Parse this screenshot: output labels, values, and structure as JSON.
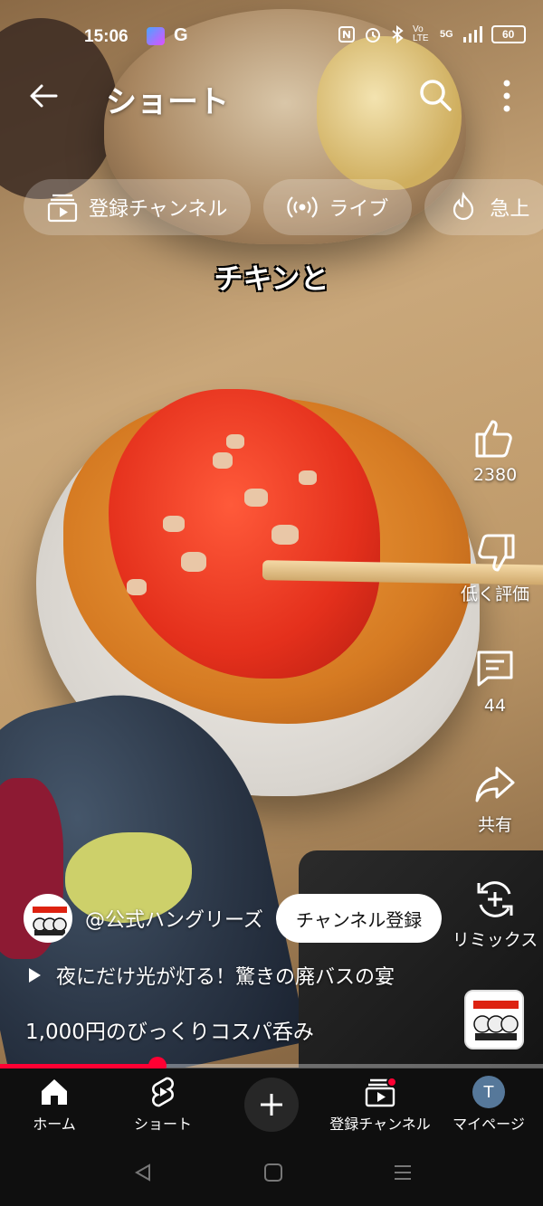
{
  "status_bar": {
    "time": "15:06",
    "g_label": "G",
    "network": "5G",
    "volte": "Vo LTE",
    "battery": "60"
  },
  "header": {
    "title": "ショート"
  },
  "chips": [
    {
      "label": "登録チャンネル",
      "icon": "subscriptions-icon"
    },
    {
      "label": "ライブ",
      "icon": "live-icon"
    },
    {
      "label": "急上",
      "icon": "trending-icon"
    }
  ],
  "video": {
    "caption": "チキンと"
  },
  "actions": {
    "like_count": "2380",
    "dislike_label": "低く評価",
    "comment_count": "44",
    "share_label": "共有",
    "remix_label": "リミックス"
  },
  "channel": {
    "handle": "@公式ハングリーズ",
    "subscribe_label": "チャンネル登録",
    "logo_text": "ハングリーズ"
  },
  "description": {
    "line1": "夜にだけ光が灯る！驚きの廃バスの宴",
    "line2": "1,000円のびっくりコスパ呑み"
  },
  "progress": {
    "fraction": 0.29
  },
  "bottom_nav": {
    "home": "ホーム",
    "shorts": "ショート",
    "subscriptions": "登録チャンネル",
    "mypage": "マイページ",
    "avatar_initial": "T"
  },
  "colors": {
    "accent": "#ff0033",
    "nav_bg": "#0f0f0f"
  }
}
